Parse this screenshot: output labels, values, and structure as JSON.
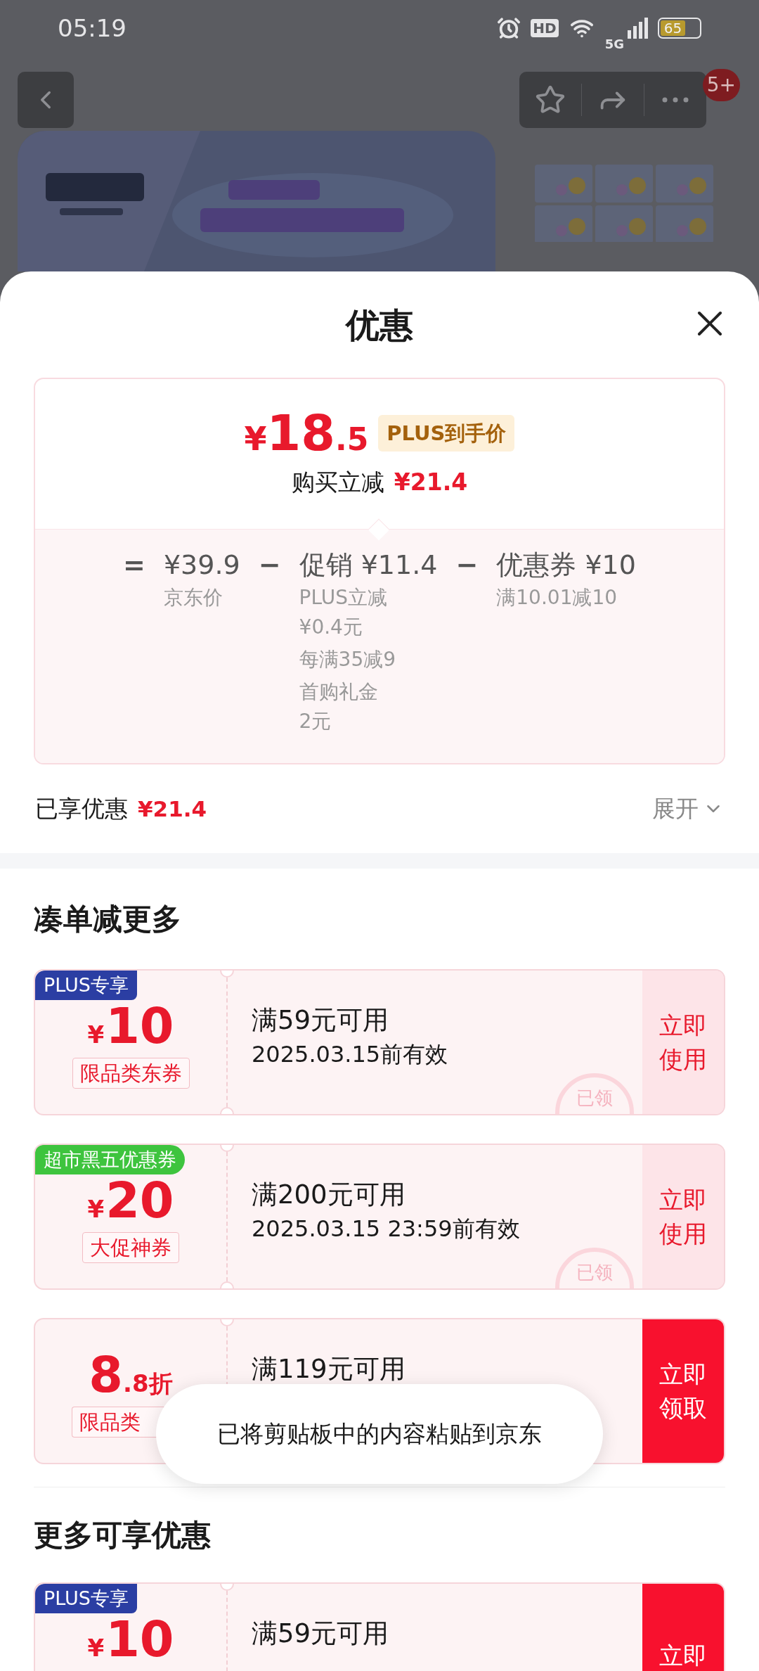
{
  "status_bar": {
    "time": "05:19",
    "hd_label": "HD",
    "network_label": "5G",
    "battery": "65"
  },
  "product_page": {
    "badge": "5+"
  },
  "sheet": {
    "title": "优惠",
    "summary": {
      "currency": "¥",
      "price_int": "18",
      "price_dec": ".5",
      "price_badge": "PLUS到手价",
      "saving_label": "购买立减",
      "saving_value": "¥21.4",
      "breakdown": [
        {
          "operator": "=",
          "value": "¥39.9",
          "notes": [
            "京东价"
          ]
        },
        {
          "operator": "−",
          "value": "促销 ¥11.4",
          "notes": [
            "PLUS立减\n¥0.4元",
            "每满35减9",
            "首购礼金\n2元"
          ]
        },
        {
          "operator": "−",
          "value": "优惠券 ¥10",
          "notes": [
            "满10.01减10"
          ]
        }
      ]
    },
    "enjoyed": {
      "label": "已享优惠",
      "value": "¥21.4",
      "toggle": "展开",
      "expanded": false
    },
    "sections": [
      {
        "title": "凑单减更多",
        "coupons": [
          {
            "tag": {
              "text": "PLUS专享",
              "color": "#2b3ea3"
            },
            "currency": "¥",
            "amount": "10",
            "label": "限品类东券",
            "condition": "满59元可用",
            "validity": "2025.03.15前有效",
            "button": "立即使用",
            "claimed": true,
            "stamp": "已领"
          },
          {
            "tag": {
              "text": "超市黑五优惠券",
              "color": "#3ec43e"
            },
            "currency": "¥",
            "amount": "20",
            "label": "大促神券",
            "condition": "满200元可用",
            "validity": "2025.03.15 23:59前有效",
            "button": "立即使用",
            "claimed": true,
            "stamp": "已领"
          },
          {
            "amount": "8",
            "amount_suffix": ".8折",
            "label": "限品类",
            "label_clipped": true,
            "condition": "满119元可用",
            "button": "立即领取",
            "claimed": false
          }
        ]
      },
      {
        "title": "更多可享优惠",
        "coupons": [
          {
            "tag": {
              "text": "PLUS专享",
              "color": "#2b3ea3"
            },
            "currency": "¥",
            "amount": "10",
            "condition": "满59元可用",
            "button": "立即",
            "claimed": false
          }
        ]
      }
    ]
  },
  "toast": "已将剪贴板中的内容粘贴到京东"
}
